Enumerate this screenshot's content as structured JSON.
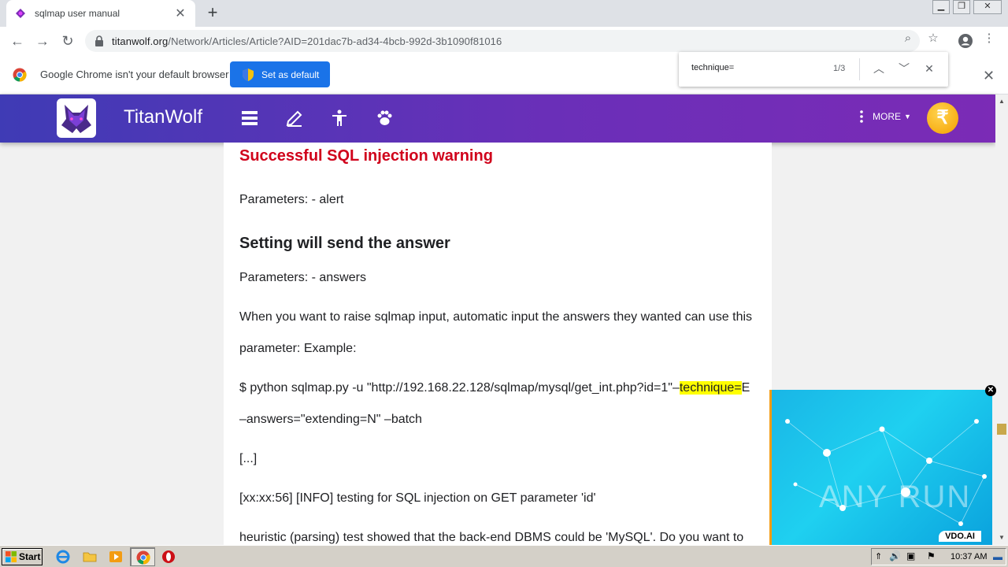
{
  "browser": {
    "tab_title": "sqlmap user manual",
    "url_host": "titanwolf.org",
    "url_path": "/Network/Articles/Article?AID=201dac7b-ad34-4bcb-992d-3b1090f81016",
    "infobar_text": "Google Chrome isn't your default browser",
    "set_default_label": "Set as default"
  },
  "findbar": {
    "query": "technique=",
    "count": "1/3"
  },
  "site": {
    "brand": "TitanWolf",
    "more_label": "MORE",
    "coin_symbol": "₹",
    "accent_start": "#3f3bb5",
    "accent_end": "#7b2bb6"
  },
  "article": {
    "heading_1": "Successful SQL injection warning",
    "para_1": "Parameters: - alert",
    "heading_2": "Setting will send the answer",
    "para_2": "Parameters: - answers",
    "para_3_line1": "When you want to raise sqlmap input, automatic input the answers they wanted can use this",
    "para_3_line2": "parameter: Example:",
    "cmd_pre": "$ python sqlmap.py -u \"http://192.168.22.128/sqlmap/mysql/get_int.php?id=1\"–",
    "cmd_highlight": "technique=",
    "cmd_post": "E",
    "cmd_line2": "–answers=\"extending=N\" –batch",
    "ellipsis": "[...]",
    "log_line": "[xx:xx:56] [INFO] testing for SQL injection on GET parameter 'id'",
    "heuristic_line": "heuristic (parsing) test showed that the back-end DBMS could be 'MySQL'. Do you want to"
  },
  "ad": {
    "badge": "VDO.AI",
    "watermark": "ANY RUN"
  },
  "taskbar": {
    "start_label": "Start",
    "clock": "10:37 AM"
  }
}
